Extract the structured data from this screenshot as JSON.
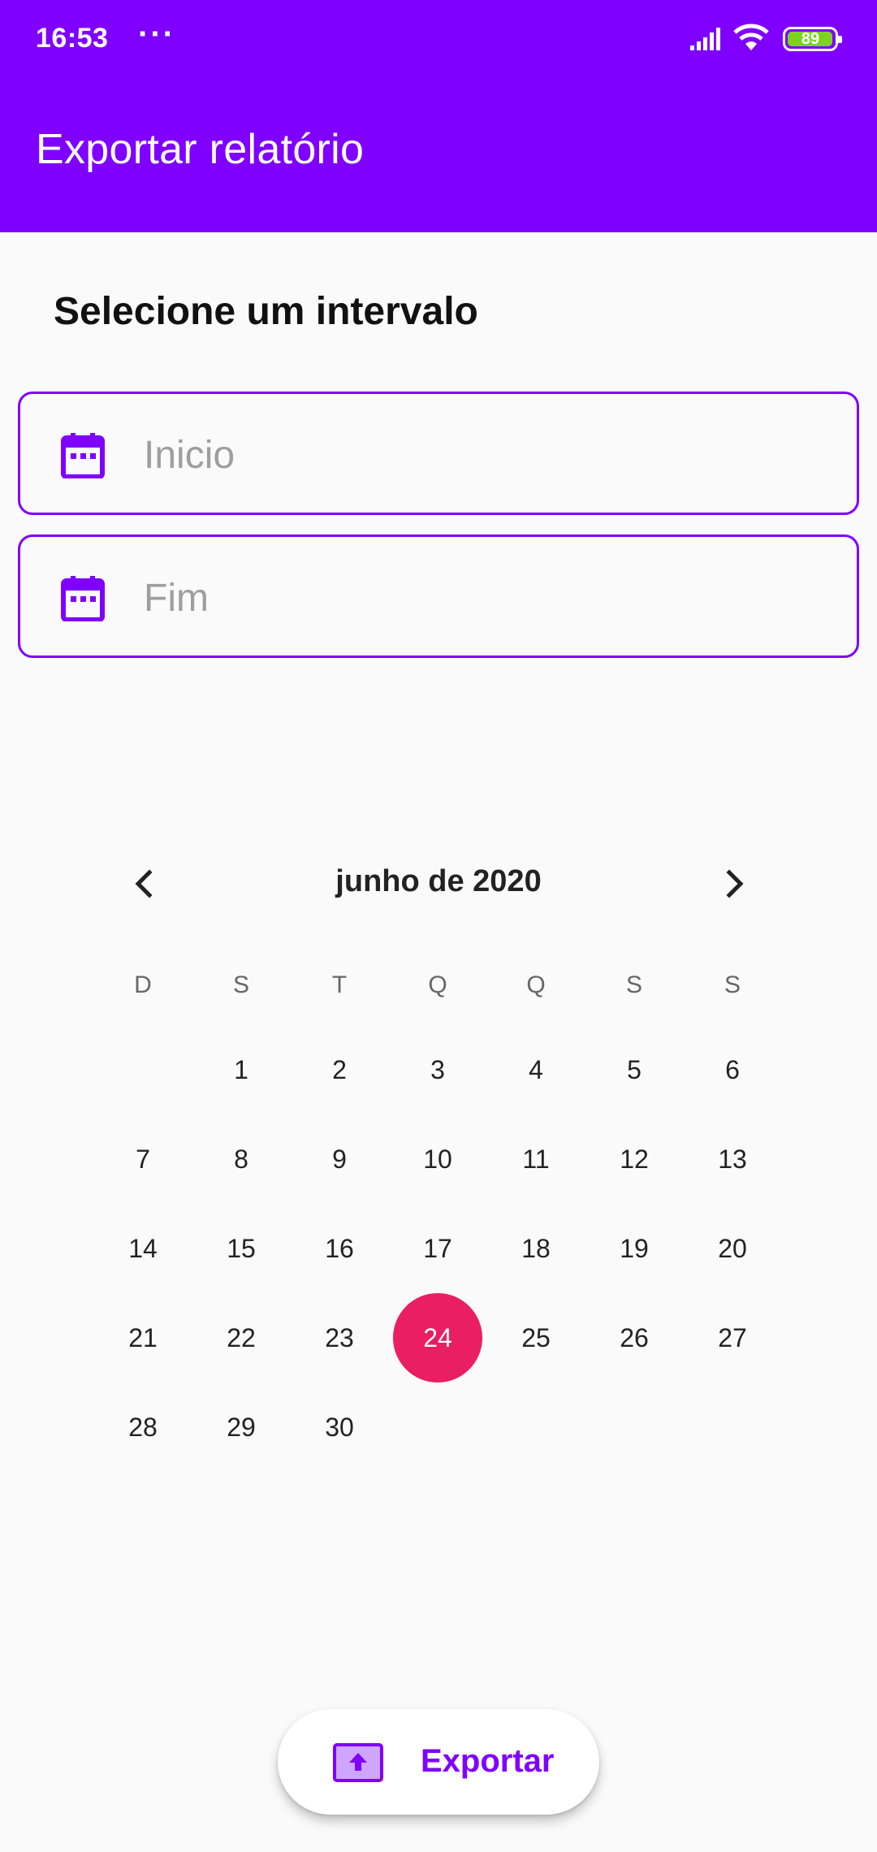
{
  "status_bar": {
    "time": "16:53",
    "dots": "···",
    "battery": "89"
  },
  "app_bar": {
    "title": "Exportar relatório"
  },
  "section": {
    "title": "Selecione um intervalo"
  },
  "fields": {
    "start_placeholder": "Inicio",
    "end_placeholder": "Fim"
  },
  "calendar": {
    "month_label": "junho de 2020",
    "weekdays": [
      "D",
      "S",
      "T",
      "Q",
      "Q",
      "S",
      "S"
    ],
    "first_weekday_index": 1,
    "days_in_month": 30,
    "selected_day": 24,
    "selected_color": "#e91e63"
  },
  "export_button": {
    "label": "Exportar"
  },
  "colors": {
    "primary": "#7f00ff",
    "accent": "#e91e63"
  }
}
